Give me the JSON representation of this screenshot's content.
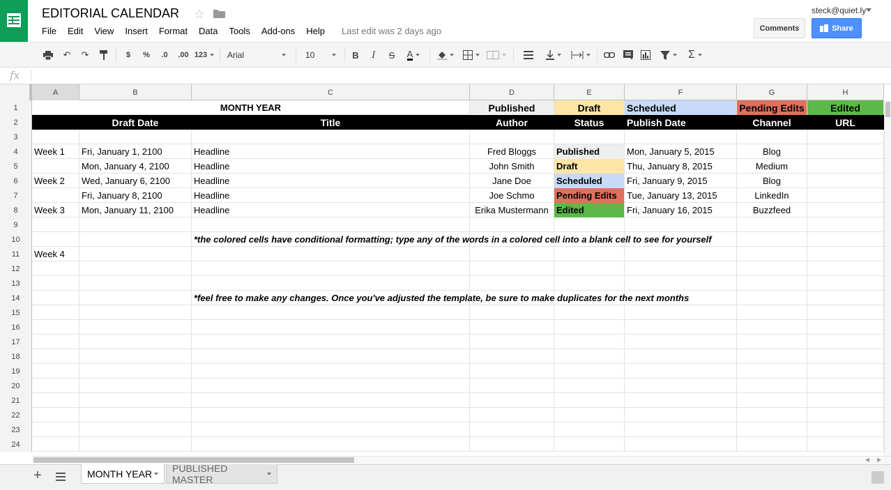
{
  "header": {
    "title": "EDITORIAL CALENDAR",
    "menu": [
      "File",
      "Edit",
      "View",
      "Insert",
      "Format",
      "Data",
      "Tools",
      "Add-ons",
      "Help"
    ],
    "last_edit": "Last edit was 2 days ago",
    "user_email": "steck@quiet.ly",
    "comments_label": "Comments",
    "share_label": "Share"
  },
  "toolbar": {
    "currency": "$",
    "percent": "%",
    "dec_decrease": ".0",
    "dec_increase": ".00",
    "more_formats": "123",
    "font": "Arial",
    "font_size": "10",
    "bold": "B",
    "italic": "I",
    "strike": "S",
    "text_color": "A",
    "functions": "Σ"
  },
  "formula_bar": {
    "fx": "fx",
    "value": ""
  },
  "columns": [
    "A",
    "B",
    "C",
    "D",
    "E",
    "F",
    "G",
    "H"
  ],
  "rows": [
    {
      "n": "1",
      "month": "MONTH YEAR",
      "legend": [
        "Published",
        "Draft",
        "Scheduled",
        "Pending Edits",
        "Edited"
      ]
    },
    {
      "n": "2",
      "headers": [
        "Draft Date",
        "Title",
        "Author",
        "Status",
        "Publish Date",
        "Channel",
        "URL"
      ]
    },
    {
      "n": "3"
    },
    {
      "n": "4",
      "week": "Week 1",
      "draft": "Fri, January 1, 2100",
      "title": "Headline",
      "author": "Fred Bloggs",
      "status": "Published",
      "publish": "Mon, January 5, 2015",
      "channel": "Blog"
    },
    {
      "n": "5",
      "week": "",
      "draft": "Mon, January 4, 2100",
      "title": "Headline",
      "author": "John Smith",
      "status": "Draft",
      "publish": "Thu, January 8, 2015",
      "channel": "Medium"
    },
    {
      "n": "6",
      "week": "Week 2",
      "draft": "Wed, January 6, 2100",
      "title": "Headline",
      "author": "Jane Doe",
      "status": "Scheduled",
      "publish": "Fri, January 9, 2015",
      "channel": "Blog"
    },
    {
      "n": "7",
      "week": "",
      "draft": "Fri, January 8, 2100",
      "title": "Headline",
      "author": "Joe Schmo",
      "status": "Pending Edits",
      "publish": "Tue, January 13, 2015",
      "channel": "LinkedIn"
    },
    {
      "n": "8",
      "week": "Week 3",
      "draft": "Mon, January 11, 2100",
      "title": "Headline",
      "author": "Erika Mustermann",
      "status": "Edited",
      "publish": "Fri, January 16, 2015",
      "channel": "Buzzfeed"
    },
    {
      "n": "9"
    },
    {
      "n": "10",
      "note": "*the colored cells have conditional formatting; type any of the words in a colored cell into a blank cell to see for yourself"
    },
    {
      "n": "11",
      "week": "Week 4"
    },
    {
      "n": "12"
    },
    {
      "n": "13"
    },
    {
      "n": "14",
      "note": "*feel free to make any changes. Once you've adjusted the template, be sure to make duplicates for the next months"
    },
    {
      "n": "15"
    },
    {
      "n": "16"
    },
    {
      "n": "17"
    },
    {
      "n": "18"
    },
    {
      "n": "19"
    },
    {
      "n": "20"
    },
    {
      "n": "21"
    },
    {
      "n": "22"
    },
    {
      "n": "23"
    },
    {
      "n": "24"
    }
  ],
  "status_colors": {
    "Published": "#efefef",
    "Draft": "#fce5a6",
    "Scheduled": "#c9daf8",
    "Pending Edits": "#e06f5d",
    "Edited": "#5cb848"
  },
  "sheets": [
    {
      "label": "MONTH YEAR",
      "active": true
    },
    {
      "label": "PUBLISHED MASTER",
      "active": false
    }
  ]
}
